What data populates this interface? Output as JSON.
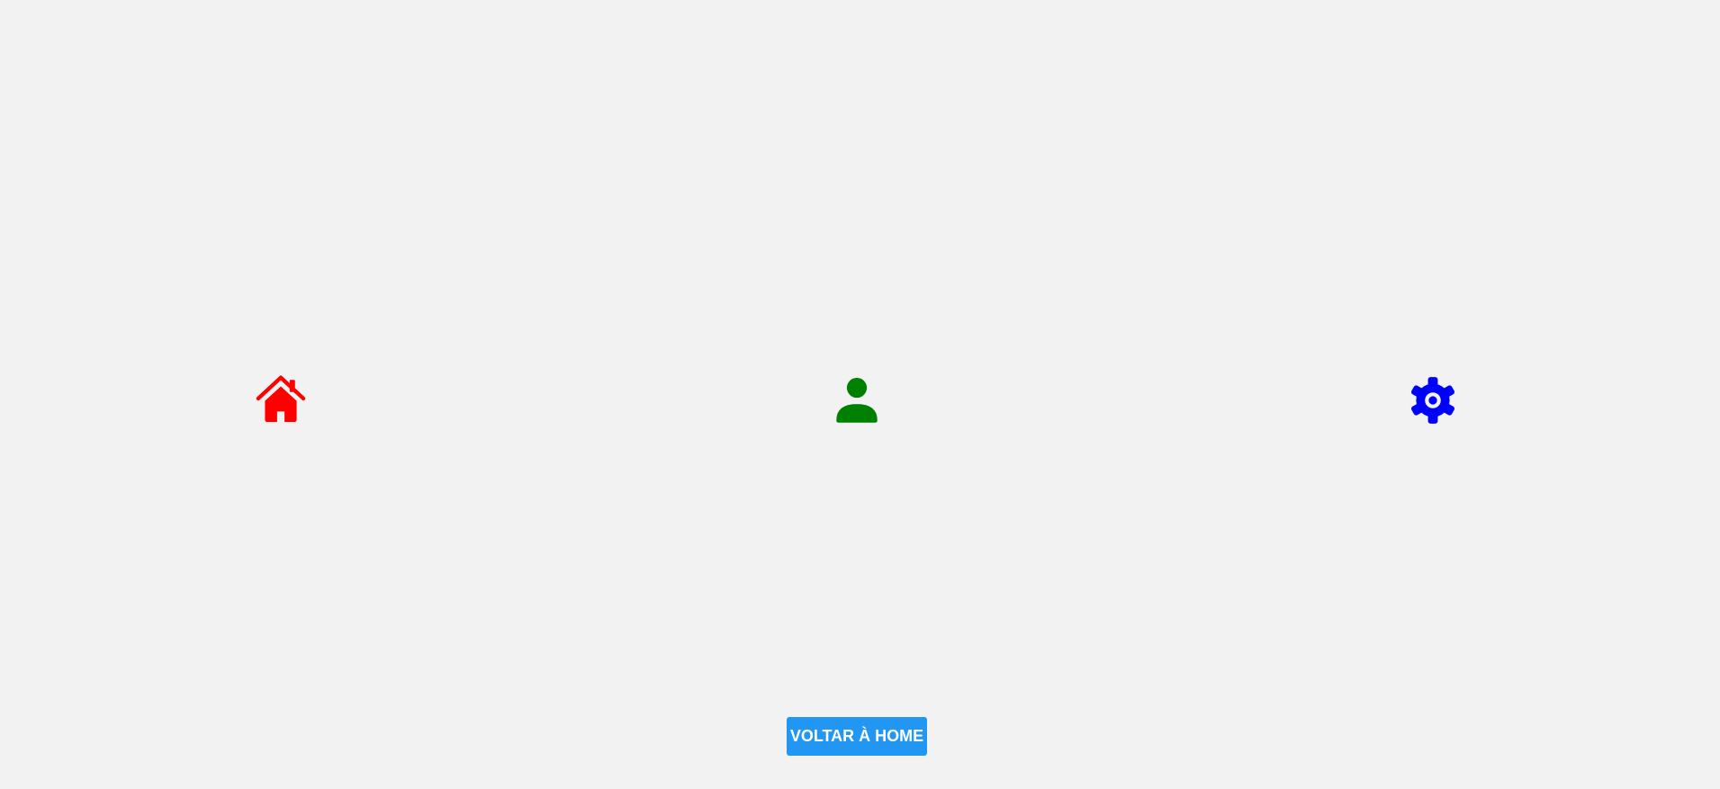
{
  "icons": [
    {
      "name": "home-icon",
      "color": "#ff0000"
    },
    {
      "name": "person-icon",
      "color": "#008000"
    },
    {
      "name": "gear-icon",
      "color": "#0000ff"
    }
  ],
  "actions": {
    "back_home_label": "VOLTAR À HOME",
    "button_color": "#2196f3",
    "button_text_color": "#ffffff"
  },
  "page": {
    "background": "#f2f2f2"
  }
}
